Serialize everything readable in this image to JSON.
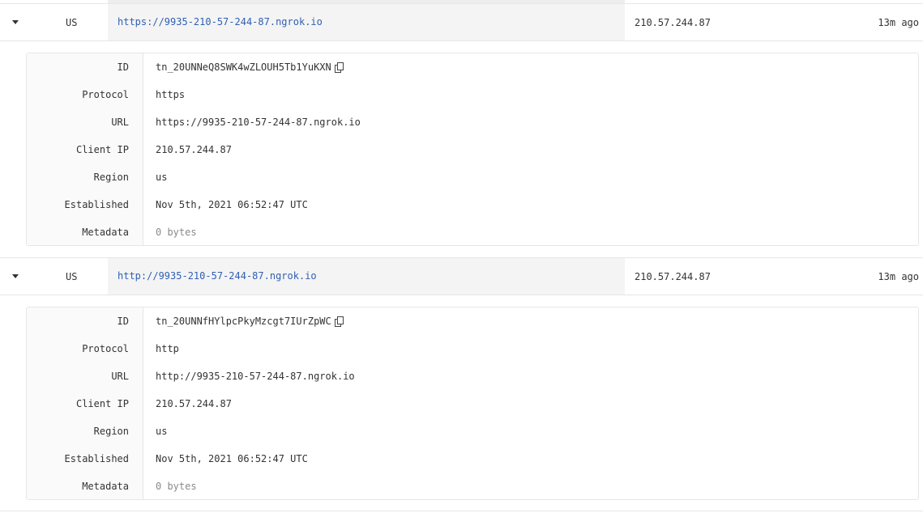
{
  "tunnels": [
    {
      "region_code": "US",
      "public_url": "https://9935-210-57-244-87.ngrok.io",
      "client_ip": "210.57.244.87",
      "age": "13m ago",
      "details": {
        "id_label": "ID",
        "id_value": "tn_20UNNeQ8SWK4wZLOUH5Tb1YuKXN",
        "protocol_label": "Protocol",
        "protocol_value": "https",
        "url_label": "URL",
        "url_value": "https://9935-210-57-244-87.ngrok.io",
        "client_ip_label": "Client IP",
        "client_ip_value": "210.57.244.87",
        "region_label": "Region",
        "region_value": "us",
        "established_label": "Established",
        "established_value": "Nov 5th, 2021 06:52:47 UTC",
        "metadata_label": "Metadata",
        "metadata_value": "0 bytes"
      }
    },
    {
      "region_code": "US",
      "public_url": "http://9935-210-57-244-87.ngrok.io",
      "client_ip": "210.57.244.87",
      "age": "13m ago",
      "details": {
        "id_label": "ID",
        "id_value": "tn_20UNNfHYlpcPkyMzcgt7IUrZpWC",
        "protocol_label": "Protocol",
        "protocol_value": "http",
        "url_label": "URL",
        "url_value": "http://9935-210-57-244-87.ngrok.io",
        "client_ip_label": "Client IP",
        "client_ip_value": "210.57.244.87",
        "region_label": "Region",
        "region_value": "us",
        "established_label": "Established",
        "established_value": "Nov 5th, 2021 06:52:47 UTC",
        "metadata_label": "Metadata",
        "metadata_value": "0 bytes"
      }
    }
  ],
  "icons": {
    "expand": "chevron-down-icon",
    "copy": "copy-icon"
  },
  "colors": {
    "link": "#2f5fb3",
    "muted": "#8a8a8a",
    "border": "#e6e6e6",
    "url_cell_bg": "#f4f4f4"
  }
}
